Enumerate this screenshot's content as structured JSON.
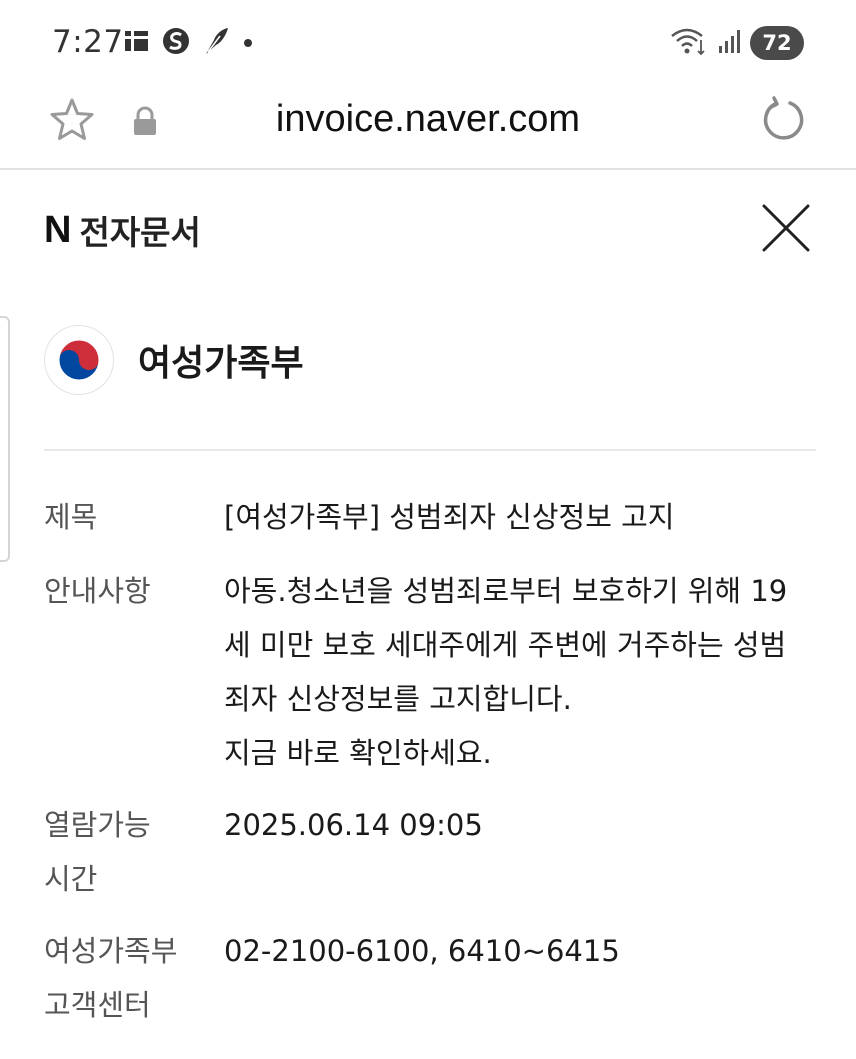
{
  "status_bar": {
    "time": "7:27",
    "battery": "72",
    "left_icons": [
      "notification-app-icon",
      "s-app-icon",
      "feather-app-icon",
      "dot-icon"
    ],
    "right_icons": [
      "wifi-icon",
      "signal-icon",
      "battery-icon"
    ]
  },
  "browser": {
    "url": "invoice.naver.com",
    "icons": [
      "star-icon",
      "lock-icon",
      "reload-icon"
    ]
  },
  "document": {
    "brand_logo": "N",
    "brand_title": "전자문서",
    "close_icon": "close-icon",
    "sender": {
      "name": "여성가족부",
      "logo_icon": "taegeuk-logo-icon"
    },
    "details": [
      {
        "label": [
          "제목"
        ],
        "value": [
          "[여성가족부] 성범죄자 신상정보 고지"
        ]
      },
      {
        "label": [
          "안내사항"
        ],
        "value": [
          "아동.청소년을 성범죄로부터 보호하기 위해 19",
          "세 미만 보호 세대주에게 주변에 거주하는 성범",
          "죄자 신상정보를 고지합니다.",
          "지금 바로 확인하세요."
        ]
      },
      {
        "label": [
          "열람가능",
          "시간"
        ],
        "value": [
          "2025.06.14 09:05"
        ]
      },
      {
        "label": [
          "여성가족부",
          "고객센터"
        ],
        "value": [
          "02-2100-6100, 6410~6415"
        ]
      }
    ]
  },
  "colors": {
    "taegeuk_red": "#cd2e3a",
    "taegeuk_blue": "#0047a0",
    "divider": "#e8e8e8",
    "label_text": "#555555"
  }
}
